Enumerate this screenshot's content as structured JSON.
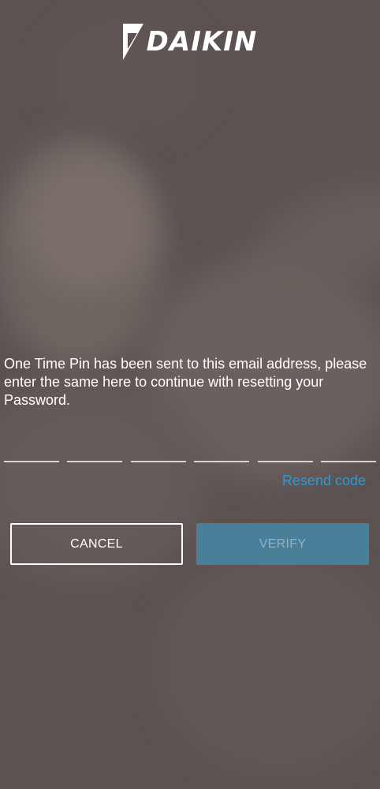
{
  "brand": {
    "logo_text": "DAIKIN"
  },
  "otp": {
    "message": "One Time Pin has been sent to this email address, please enter the same here to continue with resetting your Password.",
    "digits": [
      "",
      "",
      "",
      "",
      "",
      ""
    ],
    "resend_label": "Resend code"
  },
  "actions": {
    "cancel_label": "CANCEL",
    "verify_label": "VERIFY"
  },
  "colors": {
    "background": "#5c5252",
    "accent_link": "#2b9ad6",
    "verify_disabled": "#4a7f99"
  }
}
